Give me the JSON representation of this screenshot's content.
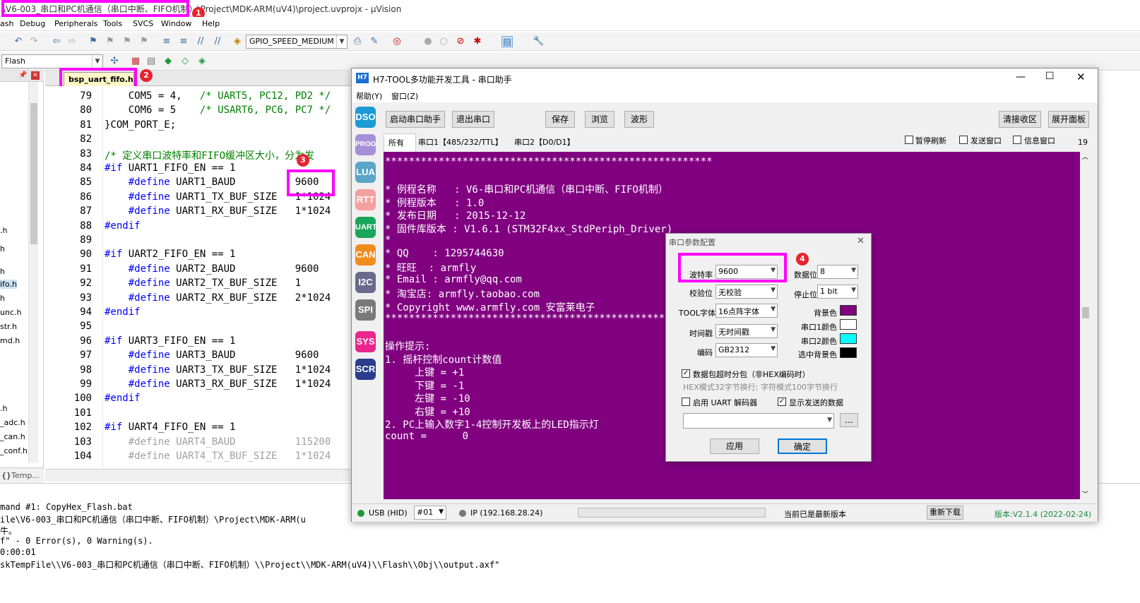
{
  "titlebar": {
    "text": "\\V6-003_串口和PC机通信（串口中断、FIFO机制）\\Project\\MDK-ARM(uV4)\\project.uvprojx - µVision"
  },
  "menu": [
    "ash",
    "Debug",
    "Peripherals",
    "Tools",
    "SVCS",
    "Window",
    "Help"
  ],
  "toolbar": {
    "target_combo": "GPIO_SPEED_MEDIUM",
    "build_target": "Flash"
  },
  "editor": {
    "tab_label": "bsp_uart_fifo.h",
    "lines": [
      {
        "n": "79",
        "segs": [
          [
            "plain",
            "    COM5 = 4,   "
          ],
          [
            "green",
            "/* UART5, PC12, PD2 */"
          ]
        ]
      },
      {
        "n": "80",
        "segs": [
          [
            "plain",
            "    COM6 = 5    "
          ],
          [
            "green",
            "/* USART6, PC6, PC7 */"
          ]
        ]
      },
      {
        "n": "81",
        "segs": [
          [
            "plain",
            "}COM_PORT_E;"
          ]
        ]
      },
      {
        "n": "82",
        "segs": [
          [
            "plain",
            ""
          ]
        ]
      },
      {
        "n": "83",
        "segs": [
          [
            "green",
            "/* 定义串口波特率和FIFO缓冲区大小，分为发"
          ]
        ]
      },
      {
        "n": "84",
        "segs": [
          [
            "blue",
            "#if"
          ],
          [
            "plain",
            " UART1_FIFO_EN == 1"
          ]
        ]
      },
      {
        "n": "85",
        "segs": [
          [
            "plain",
            "    "
          ],
          [
            "blue",
            "#define"
          ],
          [
            "plain",
            " UART1_BAUD          9600"
          ]
        ]
      },
      {
        "n": "86",
        "segs": [
          [
            "plain",
            "    "
          ],
          [
            "blue",
            "#define"
          ],
          [
            "plain",
            " UART1_TX_BUF_SIZE   1*1024"
          ]
        ]
      },
      {
        "n": "87",
        "segs": [
          [
            "plain",
            "    "
          ],
          [
            "blue",
            "#define"
          ],
          [
            "plain",
            " UART1_RX_BUF_SIZE   1*1024"
          ]
        ]
      },
      {
        "n": "88",
        "segs": [
          [
            "blue",
            "#endif"
          ]
        ]
      },
      {
        "n": "89",
        "segs": [
          [
            "plain",
            ""
          ]
        ]
      },
      {
        "n": "90",
        "segs": [
          [
            "blue",
            "#if"
          ],
          [
            "plain",
            " UART2_FIFO_EN == 1"
          ]
        ]
      },
      {
        "n": "91",
        "segs": [
          [
            "plain",
            "    "
          ],
          [
            "blue",
            "#define"
          ],
          [
            "plain",
            " UART2_BAUD          9600"
          ]
        ]
      },
      {
        "n": "92",
        "segs": [
          [
            "plain",
            "    "
          ],
          [
            "blue",
            "#define"
          ],
          [
            "plain",
            " UART2_TX_BUF_SIZE   1"
          ]
        ]
      },
      {
        "n": "93",
        "segs": [
          [
            "plain",
            "    "
          ],
          [
            "blue",
            "#define"
          ],
          [
            "plain",
            " UART2_RX_BUF_SIZE   2*1024"
          ]
        ]
      },
      {
        "n": "94",
        "segs": [
          [
            "blue",
            "#endif"
          ]
        ]
      },
      {
        "n": "95",
        "segs": [
          [
            "plain",
            ""
          ]
        ]
      },
      {
        "n": "96",
        "segs": [
          [
            "blue",
            "#if"
          ],
          [
            "plain",
            " UART3_FIFO_EN == 1"
          ]
        ]
      },
      {
        "n": "97",
        "segs": [
          [
            "plain",
            "    "
          ],
          [
            "blue",
            "#define"
          ],
          [
            "plain",
            " UART3_BAUD          9600"
          ]
        ]
      },
      {
        "n": "98",
        "segs": [
          [
            "plain",
            "    "
          ],
          [
            "blue",
            "#define"
          ],
          [
            "plain",
            " UART3_TX_BUF_SIZE   1*1024"
          ]
        ]
      },
      {
        "n": "99",
        "segs": [
          [
            "plain",
            "    "
          ],
          [
            "blue",
            "#define"
          ],
          [
            "plain",
            " UART3_RX_BUF_SIZE   1*1024"
          ]
        ]
      },
      {
        "n": "100",
        "segs": [
          [
            "blue",
            "#endif"
          ]
        ]
      },
      {
        "n": "101",
        "segs": [
          [
            "plain",
            ""
          ]
        ]
      },
      {
        "n": "102",
        "segs": [
          [
            "blue",
            "#if"
          ],
          [
            "plain",
            " UART4_FIFO_EN == 1"
          ]
        ]
      },
      {
        "n": "103",
        "segs": [
          [
            "gray",
            "    #define UART4_BAUD          115200"
          ]
        ]
      },
      {
        "n": "104",
        "segs": [
          [
            "gray",
            "    #define UART4_TX_BUF_SIZE   1*1024"
          ]
        ]
      }
    ]
  },
  "left_panel": {
    "items": [
      ".h",
      "h",
      "ifo.h",
      "h",
      "unc.h",
      "str.h",
      "md.h",
      ".h",
      "_adc.h",
      "_can.h",
      "_conf.h",
      "{}",
      "Temp..."
    ]
  },
  "build_output": [
    "mand #1: CopyHex_Flash.bat",
    "ile\\V6-003_串口和PC机通信（串口中断、FIFO机制）\\Project\\MDK-ARM(u",
    "牛。",
    "f\" - 0 Error(s), 0 Warning(s).",
    "0:00:01",
    "skTempFile\\\\V6-003_串口和PC机通信（串口中断、FIFO机制）\\\\Project\\\\MDK-ARM(uV4)\\\\Flash\\\\Obj\\\\output.axf\""
  ],
  "tool": {
    "title": "H7-TOOL多功能开发工具 - 串口助手",
    "menu": [
      "帮助(Y)",
      "窗口(Z)"
    ],
    "side": [
      {
        "label": "DSO",
        "color": "#1b9ad6"
      },
      {
        "label": "PROG",
        "color": "#a58fd6"
      },
      {
        "label": "LUA",
        "color": "#5aa5c8"
      },
      {
        "label": "RTT",
        "color": "#f4a0a0"
      },
      {
        "label": "UART",
        "color": "#19a55a"
      },
      {
        "label": "CAN",
        "color": "#f08c1e"
      },
      {
        "label": "I2C",
        "color": "#6a6a8c"
      },
      {
        "label": "SPI",
        "color": "#7a7a7a"
      },
      {
        "label": "SYS",
        "color": "#e8268c"
      },
      {
        "label": "SCR",
        "color": "#2a3c8c"
      }
    ],
    "buttons": {
      "start": "启动串口助手",
      "exit": "退出串口",
      "save": "保存",
      "browse": "浏览",
      "wave": "波形",
      "clear": "清接收区",
      "expand": "展开面板"
    },
    "tabs": [
      "所有",
      "串口1【485/232/TTL】",
      "串口2【D0/D1】"
    ],
    "checks": {
      "pause": "暂停刷新",
      "send": "发送窗口",
      "info": "信息窗口"
    },
    "count": "19",
    "terminal": [
      "*******************************************************",
      "",
      "* 例程名称   : V6-串口和PC机通信（串口中断、FIFO机制）",
      "* 例程版本   : 1.0",
      "* 发布日期   : 2015-12-12",
      "* 固件库版本 : V1.6.1 (STM32F4xx_StdPeriph_Driver)",
      "*",
      "* QQ    : 1295744630",
      "* 旺旺  : armfly",
      "* Email : armfly@qq.com",
      "* 淘宝店: armfly.taobao.com",
      "* Copyright www.armfly.com 安富莱电子",
      "*******************************************************",
      "",
      "操作提示:",
      "1. 摇杆控制count计数值",
      "     上键 = +1",
      "     下键 = -1",
      "     左键 = -10",
      "     右键 = +10",
      "2. PC上输入数字1-4控制开发板上的LED指示灯",
      "count =      0"
    ],
    "status": {
      "usb": "USB (HID)",
      "port": "#01",
      "ip": "IP (192.168.28.24)",
      "latest": "当前已是最新版本",
      "redownload": "重新下载",
      "version": "版本:V2.1.4 (2022-02-24)"
    }
  },
  "dialog": {
    "title": "串口参数配置",
    "baud_label": "波特率",
    "baud": "9600",
    "databits_label": "数据位",
    "databits": "8",
    "parity_label": "校验位",
    "parity": "无校验",
    "stopbits_label": "停止位",
    "stopbits": "1 bit",
    "font_label": "TOOL字体",
    "font": "16点阵字体",
    "bg_label": "背景色",
    "bg_color": "#800080",
    "timestamp_label": "时间戳",
    "timestamp": "无时间戳",
    "port1_color_label": "串口1颜色",
    "port1_color": "#ffffff",
    "port2_color_label": "串口2颜色",
    "port2_color": "#00ffff",
    "encoding_label": "编码",
    "encoding": "GB2312",
    "sel_bg_label": "选中背景色",
    "sel_bg_color": "#000000",
    "split_label": "数据包超时分包（非HEX编码时）",
    "hint": "HEX模式32字节换行; 字符模式100字节换行",
    "decoder_label": "启用 UART 解码器",
    "show_sent_label": "显示发送的数据",
    "more": "...",
    "apply": "应用",
    "ok": "确定"
  },
  "badges": [
    "1",
    "2",
    "3",
    "4"
  ],
  "highlight_color": "#ff00ff"
}
